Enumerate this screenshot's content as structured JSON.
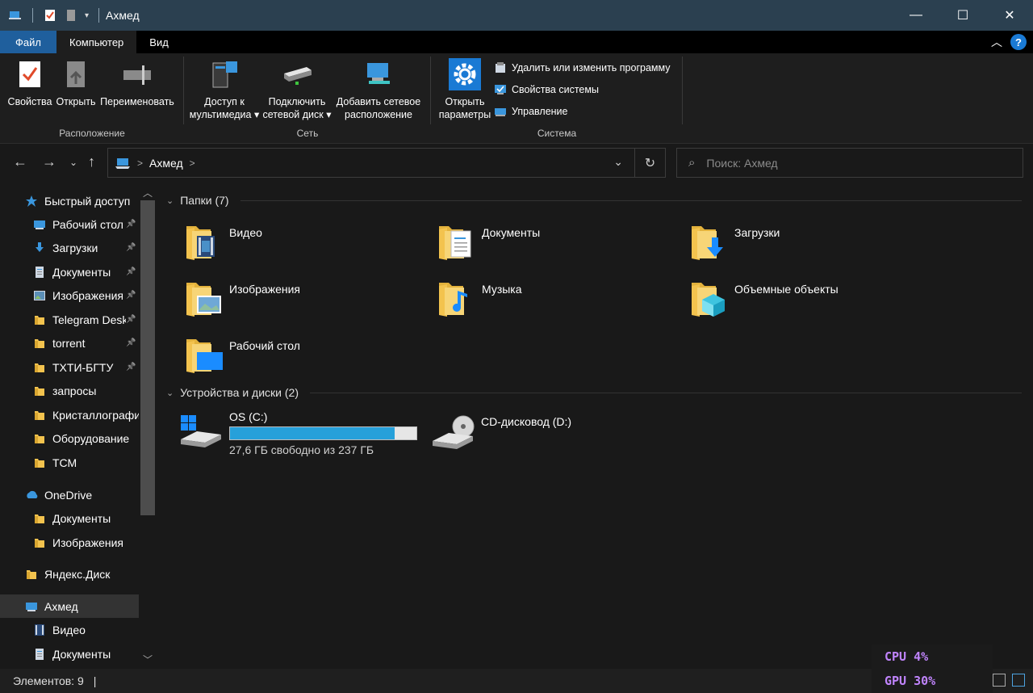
{
  "window": {
    "title": "Ахмед",
    "minimize": "—",
    "maximize": "☐",
    "close": "✕"
  },
  "ribbon_tabs": [
    "Файл",
    "Компьютер",
    "Вид"
  ],
  "ribbon": {
    "location": {
      "label": "Расположение",
      "buttons": [
        "Свойства",
        "Открыть",
        "Переименовать"
      ]
    },
    "network": {
      "label": "Сеть",
      "buttons": [
        {
          "line1": "Доступ к",
          "line2": "мультимедиа ▾"
        },
        {
          "line1": "Подключить",
          "line2": "сетевой диск ▾"
        },
        {
          "line1": "Добавить сетевое",
          "line2": "расположение"
        }
      ]
    },
    "system": {
      "label": "Система",
      "open_params": {
        "line1": "Открыть",
        "line2": "параметры"
      },
      "small": [
        "Удалить или изменить программу",
        "Свойства системы",
        "Управление"
      ]
    }
  },
  "address": {
    "crumb": "Ахмед",
    "separator": ">"
  },
  "search": {
    "placeholder": "Поиск: Ахмед"
  },
  "sidebar": {
    "items": [
      {
        "label": "Быстрый доступ",
        "icon": "star-icon",
        "color": "#3a96dd",
        "indent": 0,
        "pinned": false
      },
      {
        "label": "Рабочий стол",
        "icon": "desktop-icon",
        "color": "#3a96dd",
        "indent": 1,
        "pinned": true
      },
      {
        "label": "Загрузки",
        "icon": "download-icon",
        "color": "#3a96dd",
        "indent": 1,
        "pinned": true
      },
      {
        "label": "Документы",
        "icon": "document-icon",
        "color": "#cfd8e3",
        "indent": 1,
        "pinned": true
      },
      {
        "label": "Изображения",
        "icon": "image-icon",
        "color": "#cfd8e3",
        "indent": 1,
        "pinned": true
      },
      {
        "label": "Telegram Desktop",
        "icon": "folder-icon",
        "color": "#f3c34e",
        "indent": 1,
        "pinned": true
      },
      {
        "label": "torrent",
        "icon": "folder-icon",
        "color": "#f3c34e",
        "indent": 1,
        "pinned": true
      },
      {
        "label": "ТХТИ-БГТУ",
        "icon": "folder-icon",
        "color": "#f3c34e",
        "indent": 1,
        "pinned": true
      },
      {
        "label": "запросы",
        "icon": "folder-icon",
        "color": "#f3c34e",
        "indent": 1,
        "pinned": false
      },
      {
        "label": "Кристаллография",
        "icon": "folder-icon",
        "color": "#f3c34e",
        "indent": 1,
        "pinned": false
      },
      {
        "label": "Оборудование",
        "icon": "folder-icon",
        "color": "#f3c34e",
        "indent": 1,
        "pinned": false
      },
      {
        "label": "ТСМ",
        "icon": "folder-icon",
        "color": "#f3c34e",
        "indent": 1,
        "pinned": false
      },
      {
        "label": "OneDrive",
        "icon": "cloud-icon",
        "color": "#3a96dd",
        "indent": 0,
        "pinned": false
      },
      {
        "label": "Документы",
        "icon": "folder-icon",
        "color": "#f3c34e",
        "indent": 1,
        "pinned": false
      },
      {
        "label": "Изображения",
        "icon": "folder-icon",
        "color": "#f3c34e",
        "indent": 1,
        "pinned": false
      },
      {
        "label": "Яндекс.Диск",
        "icon": "folder-icon",
        "color": "#f3c34e",
        "indent": 0,
        "pinned": false
      },
      {
        "label": "Ахмед",
        "icon": "computer-icon",
        "color": "#3a96dd",
        "indent": 0,
        "pinned": false,
        "selected": true
      },
      {
        "label": "Видео",
        "icon": "video-icon",
        "color": "#cfd8e3",
        "indent": 1,
        "pinned": false
      },
      {
        "label": "Документы",
        "icon": "document-icon",
        "color": "#cfd8e3",
        "indent": 1,
        "pinned": false
      }
    ]
  },
  "content": {
    "folders_header": "Папки (7)",
    "folders": [
      {
        "name": "Видео",
        "icon": "video-folder-icon"
      },
      {
        "name": "Документы",
        "icon": "documents-folder-icon"
      },
      {
        "name": "Загрузки",
        "icon": "downloads-folder-icon"
      },
      {
        "name": "Изображения",
        "icon": "pictures-folder-icon"
      },
      {
        "name": "Музыка",
        "icon": "music-folder-icon"
      },
      {
        "name": "Объемные объекты",
        "icon": "3d-objects-folder-icon"
      },
      {
        "name": "Рабочий стол",
        "icon": "desktop-folder-icon"
      }
    ],
    "drives_header": "Устройства и диски (2)",
    "drives": [
      {
        "name": "OS (C:)",
        "free_text": "27,6 ГБ свободно из 237 ГБ",
        "used_fraction": 0.884,
        "icon": "hard-drive-icon"
      },
      {
        "name": "CD-дисковод (D:)",
        "icon": "cd-drive-icon"
      }
    ]
  },
  "status": {
    "items": "Элементов: 9",
    "cursor": "|"
  },
  "perf": {
    "cpu": "CPU  4%",
    "gpu": "GPU 30%"
  },
  "colors": {
    "accent": "#26a0da",
    "folder": "#f3c34e",
    "titlebar": "#2b4050",
    "file_tab": "#1f5f9d"
  }
}
